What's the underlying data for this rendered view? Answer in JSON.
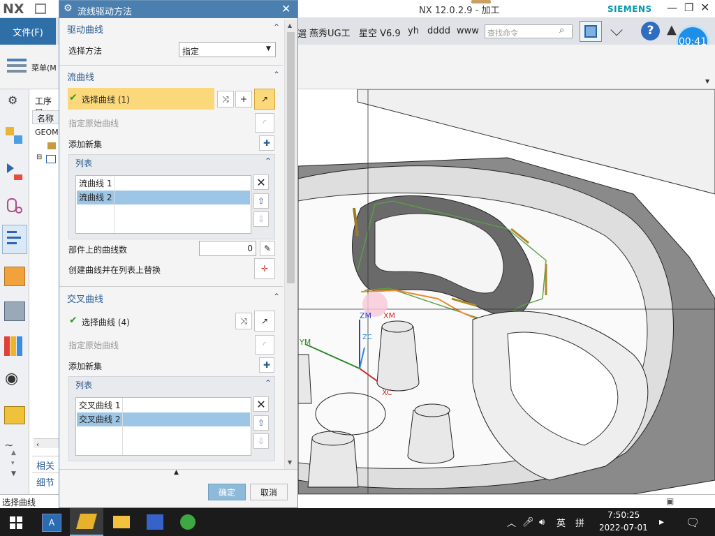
{
  "app": {
    "logo": "NX",
    "window_title": "NX 12.0.2.9 - 加工",
    "brand": "SIEMENS",
    "timer": "00:41"
  },
  "ribbon": {
    "file_menu": "文件(F)",
    "menu_label": "菜单(M",
    "quick_items": [
      "燕秀UG工",
      "星空 V6.9",
      "yh",
      "dddd",
      "www"
    ],
    "search_placeholder": "查找命令"
  },
  "navigator": {
    "title": "工序导",
    "col_name": "名称",
    "root": "GEOM",
    "tabs": [
      "相关",
      "细节"
    ]
  },
  "dialog": {
    "title": "流线驱动方法",
    "drive_curve": {
      "header": "驱动曲线",
      "method_label": "选择方法",
      "method_value": "指定"
    },
    "flow_curves": {
      "header": "流曲线",
      "select_label": "选择曲线 (1)",
      "origin_label": "指定原始曲线",
      "add_set_label": "添加新集",
      "list_header": "列表",
      "items": [
        "流曲线 1",
        "流曲线 2"
      ],
      "count_label": "部件上的曲线数",
      "count_value": "0",
      "replace_label": "创建曲线并在列表上替换"
    },
    "cross_curves": {
      "header": "交叉曲线",
      "select_label": "选择曲线 (4)",
      "origin_label": "指定原始曲线",
      "add_set_label": "添加新集",
      "list_header": "列表",
      "items": [
        "交叉曲线 1",
        "交叉曲线 2"
      ]
    },
    "ok_label": "确定",
    "cancel_label": "取消"
  },
  "viewport_labels": {
    "zm": "ZM",
    "xm": "XM",
    "ym": "YM",
    "zc": "ZC",
    "xc": "XC"
  },
  "status": {
    "prompt": "选择曲线"
  },
  "taskbar": {
    "ime": "英",
    "ime2": "拼",
    "time": "7:50:25",
    "date": "2022-07-01"
  },
  "colors": {
    "dialog_header": "#4a7fb0",
    "selection_highlight": "#fbd87a",
    "list_selected": "#9cc5e6",
    "file_menu": "#2e6fa8",
    "timer_badge": "#1e8ee6"
  }
}
